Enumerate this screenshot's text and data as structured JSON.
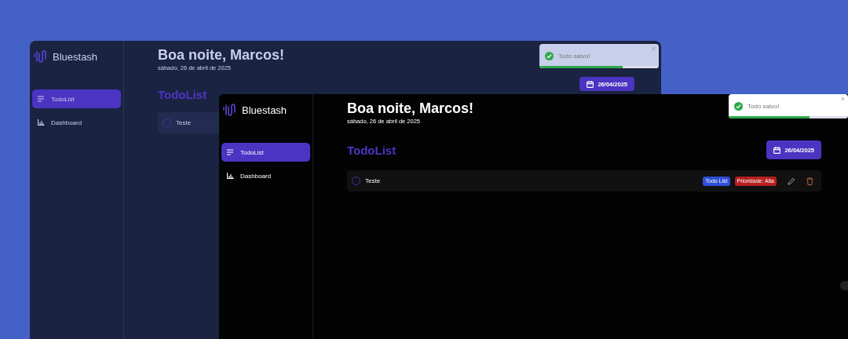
{
  "windows": [
    {
      "kind": "navy",
      "sidebar": {
        "logo": "Bluestash",
        "items": [
          {
            "label": "TodoList",
            "selected": true
          },
          {
            "label": "Dashboard",
            "selected": false
          }
        ]
      },
      "header": {
        "greeting": "Boa noite, Marcos!",
        "date": "sábado, 26 de abril de 2025"
      },
      "heading": "TodoList",
      "date_button": "26/04/2025",
      "tasks": [
        {
          "title": "Teste",
          "done": false
        }
      ],
      "toast": {
        "message": "Todo salvo!",
        "close": "×",
        "level": 0.7
      }
    },
    {
      "kind": "black",
      "sidebar": {
        "logo": "Bluestash",
        "items": [
          {
            "label": "TodoList",
            "selected": true
          },
          {
            "label": "Dashboard",
            "selected": false
          }
        ]
      },
      "header": {
        "greeting": "Boa noite, Marcos!",
        "date": "sábado, 26 de abril de 2025"
      },
      "heading": "TodoList",
      "date_button": "26/04/2025",
      "tasks": [
        {
          "title": "Teste",
          "done": false,
          "tags": [
            {
              "label": "Todo List",
              "color": "#2f4fd8"
            },
            {
              "label": "Prioridade: Alta",
              "color": "#b51f1f"
            }
          ]
        }
      ],
      "toast": {
        "message": "Todo salvo!",
        "close": "×",
        "level": 0.68
      }
    }
  ]
}
